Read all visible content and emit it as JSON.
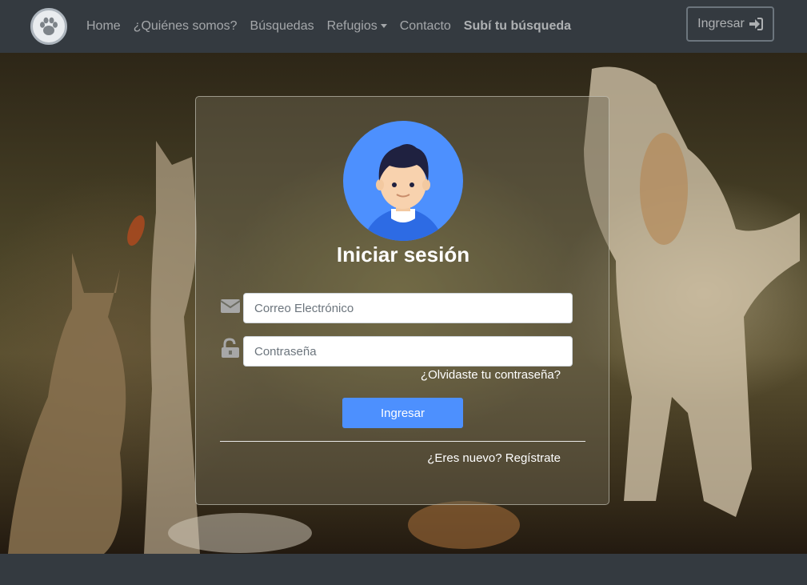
{
  "navbar": {
    "brand_icon": "paw-icon",
    "links": [
      {
        "label": "Home"
      },
      {
        "label": "¿Quiénes somos?"
      },
      {
        "label": "Búsquedas"
      },
      {
        "label": "Refugios"
      },
      {
        "label": "Contacto"
      },
      {
        "label": "Subí tu búsqueda"
      }
    ],
    "login_label": "Ingresar",
    "login_icon": "sign-in-icon"
  },
  "login": {
    "avatar_icon": "user-avatar-icon",
    "title": "Iniciar sesión",
    "email_icon": "envelope-icon",
    "email_placeholder": "Correo Electrónico",
    "email_value": "",
    "password_icon": "unlock-icon",
    "password_placeholder": "Contraseña",
    "password_value": "",
    "forgot_label": "¿Olvidaste tu contraseña?",
    "submit_label": "Ingresar",
    "register_label": "¿Eres nuevo? Regístrate"
  },
  "colors": {
    "navbar_bg": "#343a40",
    "accent": "#4d90fe"
  }
}
